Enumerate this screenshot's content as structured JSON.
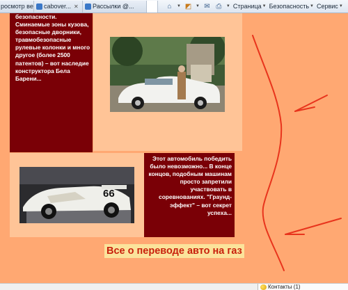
{
  "browser": {
    "tabs": [
      {
        "label": "росмотр ве..."
      },
      {
        "label": "cabover..."
      },
      {
        "label": "Рассылки @..."
      },
      {
        "label": ""
      }
    ],
    "toolbar": {
      "page_menu": "Страница",
      "security_menu": "Безопасность",
      "service_menu": "Сервис"
    }
  },
  "content": {
    "block1_text": "безопасности. Сминаемые зоны кузова, безопасные дворники, травмобезопасные рулевые колонки и много другое (более 2500 патентов) – вот наследие конструктора Бела Барени...",
    "block2_text": "Этот автомобиль победить было невозможно... В конце концов, подобным машинам просто запретили участвовать в соревнованиях. \"Граунд-эффект\" – вот секрет успеха...",
    "race_car_number": "66",
    "headline": "Все о переводе авто на газ"
  },
  "statusbar": {
    "contacts": "Контакты (1)"
  },
  "colors": {
    "page_bg": "#ffa872",
    "light_panel": "#ffc497",
    "dark_panel": "#7a0006",
    "headline_text": "#c8200c",
    "headline_bg": "#fbe39b",
    "annotation_stroke": "#e8341c"
  },
  "icons": [
    "tab-favicon-icon",
    "close-icon",
    "home-icon",
    "rss-icon",
    "mail-icon",
    "print-icon",
    "chevron-down-icon",
    "contacts-icon"
  ]
}
